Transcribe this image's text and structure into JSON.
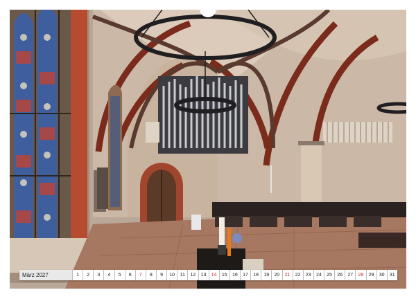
{
  "calendar": {
    "month_label": "März 2027",
    "accent_color": "#d22a2a",
    "days": [
      {
        "n": "1",
        "sun": false
      },
      {
        "n": "2",
        "sun": false
      },
      {
        "n": "3",
        "sun": false
      },
      {
        "n": "4",
        "sun": false
      },
      {
        "n": "5",
        "sun": false
      },
      {
        "n": "6",
        "sun": false
      },
      {
        "n": "7",
        "sun": true
      },
      {
        "n": "8",
        "sun": false
      },
      {
        "n": "9",
        "sun": false
      },
      {
        "n": "10",
        "sun": false
      },
      {
        "n": "11",
        "sun": false
      },
      {
        "n": "12",
        "sun": false
      },
      {
        "n": "13",
        "sun": false
      },
      {
        "n": "14",
        "sun": true
      },
      {
        "n": "15",
        "sun": false
      },
      {
        "n": "16",
        "sun": false
      },
      {
        "n": "17",
        "sun": false
      },
      {
        "n": "18",
        "sun": false
      },
      {
        "n": "19",
        "sun": false
      },
      {
        "n": "20",
        "sun": false
      },
      {
        "n": "21",
        "sun": true
      },
      {
        "n": "22",
        "sun": false
      },
      {
        "n": "23",
        "sun": false
      },
      {
        "n": "24",
        "sun": false
      },
      {
        "n": "25",
        "sun": false
      },
      {
        "n": "26",
        "sun": false
      },
      {
        "n": "27",
        "sun": false
      },
      {
        "n": "28",
        "sun": true
      },
      {
        "n": "29",
        "sun": false
      },
      {
        "n": "30",
        "sun": false
      },
      {
        "n": "31",
        "sun": false
      }
    ]
  },
  "photo": {
    "subject": "church-interior",
    "palette": {
      "wall": "#cdb9a8",
      "rib": "#8a3a28",
      "floor": "#a87a62",
      "pillar": "#d4c2ad"
    }
  }
}
